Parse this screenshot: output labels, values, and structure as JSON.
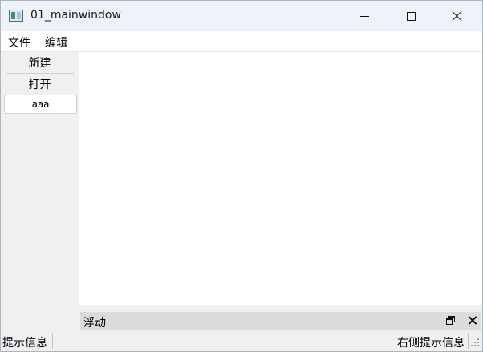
{
  "window": {
    "title": "01_mainwindow"
  },
  "menubar": {
    "items": [
      "文件",
      "编辑"
    ]
  },
  "toolbar": {
    "new_label": "新建",
    "open_label": "打开",
    "aaa_label": "aaa"
  },
  "dock": {
    "title": "浮动"
  },
  "statusbar": {
    "left_text": "提示信息",
    "right_text": "右侧提示信息"
  },
  "colors": {
    "titlebar_bg": "#eef2f9",
    "window_bg": "#f0f0f0",
    "central_bg": "#ffffff",
    "dock_title_bg": "#dcdcdc"
  },
  "icons": {
    "app": "app-window-icon",
    "minimize": "minimize-icon",
    "maximize": "maximize-icon",
    "close": "close-icon",
    "dock_float": "dock-float-icon",
    "dock_close": "dock-close-icon",
    "size_grip": "size-grip-icon"
  }
}
